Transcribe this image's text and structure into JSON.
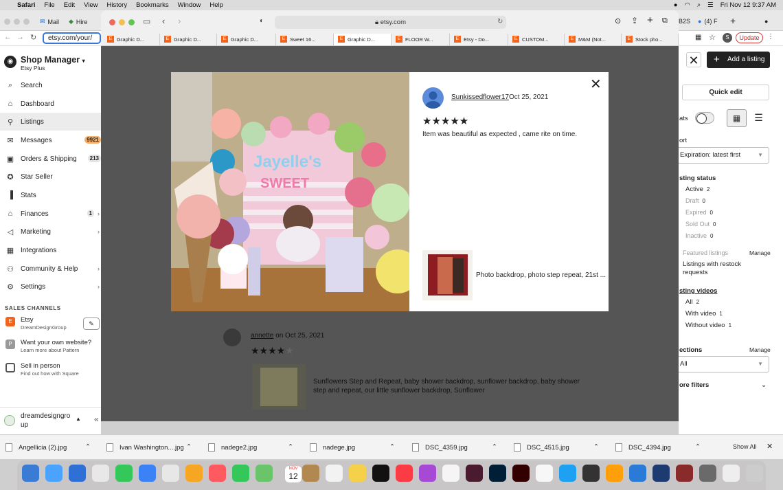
{
  "menubar": {
    "apple": "",
    "items": [
      "Safari",
      "File",
      "Edit",
      "View",
      "History",
      "Bookmarks",
      "Window",
      "Help"
    ],
    "datetime": "Fri Nov 12  9:37 AM"
  },
  "back_browser": {
    "tabs": [
      "Mail",
      "Hire",
      "B2S",
      "(4) F"
    ],
    "url": "etsy.com/your/",
    "update_label": "Update",
    "avatar_letter": "S"
  },
  "front_browser": {
    "url": "etsy.com",
    "tabs": [
      "Graphic D...",
      "Graphic D...",
      "Graphic D...",
      "Sweet 16...",
      "Graphic D...",
      "FLOOR W...",
      "Etsy - Do...",
      "CUSTOM...",
      "M&M (Not...",
      "Stock pho..."
    ],
    "selected_tab_index": 4
  },
  "sidebar": {
    "title": "Shop Manager",
    "subtitle": "Etsy Plus",
    "items": [
      {
        "label": "Search",
        "icon": "search-icon"
      },
      {
        "label": "Dashboard",
        "icon": "home-icon"
      },
      {
        "label": "Listings",
        "icon": "listings-icon"
      },
      {
        "label": "Messages",
        "icon": "mail-icon",
        "badge": "9921"
      },
      {
        "label": "Orders & Shipping",
        "icon": "box-icon",
        "badge": "213"
      },
      {
        "label": "Star Seller",
        "icon": "star-icon"
      },
      {
        "label": "Stats",
        "icon": "bar-chart-icon"
      },
      {
        "label": "Finances",
        "icon": "bank-icon",
        "badge": "1"
      },
      {
        "label": "Marketing",
        "icon": "megaphone-icon"
      },
      {
        "label": "Integrations",
        "icon": "grid-icon"
      },
      {
        "label": "Community & Help",
        "icon": "people-icon"
      },
      {
        "label": "Settings",
        "icon": "gear-icon"
      }
    ],
    "sales_channels_heading": "SALES CHANNELS",
    "channels": [
      {
        "title": "Etsy",
        "subtitle": "DreamDesignGroup",
        "icon_letter": "E"
      },
      {
        "title": "Want your own website?",
        "subtitle": "Learn more about Pattern",
        "icon_letter": "P"
      },
      {
        "title": "Sell in person",
        "subtitle": "Find out how with Square",
        "icon_letter": ""
      }
    ],
    "shop_name_line1": "dreamdesigngro",
    "shop_name_line2": "up",
    "collapse_glyph": "«"
  },
  "right_panel": {
    "add_listing": "Add a listing",
    "quick_edit": "Quick edit",
    "stats_label": "ats",
    "sort_label": "ort",
    "sort_value": "Expiration: latest first",
    "listing_status_label": "sting status",
    "statuses": [
      {
        "label": "Active",
        "count": "2"
      },
      {
        "label": "Draft",
        "count": "0"
      },
      {
        "label": "Expired",
        "count": "0"
      },
      {
        "label": "Sold Out",
        "count": "0"
      },
      {
        "label": "Inactive",
        "count": "0"
      }
    ],
    "featured_label": "Featured listings",
    "manage_label": "Manage",
    "restock_line1": "Listings with restock",
    "restock_line2": "requests",
    "videos_label": "sting videos",
    "videos": [
      {
        "label": "All",
        "count": "2"
      },
      {
        "label": "With video",
        "count": "1"
      },
      {
        "label": "Without video",
        "count": "1"
      }
    ],
    "sections_label": "ections",
    "sections_manage": "Manage",
    "sections_value": "All",
    "more_filters": "ore filters"
  },
  "modal": {
    "reviewer": "Sunkissedflower17",
    "date": "Oct 25, 2021",
    "stars": "★★★★★",
    "review_text": "Item was beautiful as expected , came rite on time.",
    "listing_title": "Photo backdrop, photo step repeat, 21st ...",
    "close_glyph": "✕",
    "photo_banner_text": "Jayelle's",
    "photo_banner_sub": "SWEET"
  },
  "review_below": {
    "reviewer": "annette",
    "date_prefix": "on Oct 25, 2021",
    "stars": "★★★★",
    "empty_star": "★",
    "listing_line1": "Sunflowers Step and Repeat, baby shower backdrop, sunflower backdrop, baby shower",
    "listing_line2": "step and repeat, our little sunflower backdrop, Sunflower"
  },
  "downloads": {
    "files": [
      "Angellicia (2).jpg",
      "Ivan Washington....jpg",
      "nadege2.jpg",
      "nadege.jpg",
      "DSC_4359.jpg",
      "DSC_4515.jpg",
      "DSC_4394.jpg"
    ],
    "show_all": "Show All",
    "close_glyph": "✕"
  },
  "dock": {
    "calendar_month": "NOV",
    "calendar_day": "12"
  },
  "colors": {
    "etsy_orange": "#f1641e",
    "overlay": "#4b4b4b",
    "badge": "#f2b06b"
  }
}
